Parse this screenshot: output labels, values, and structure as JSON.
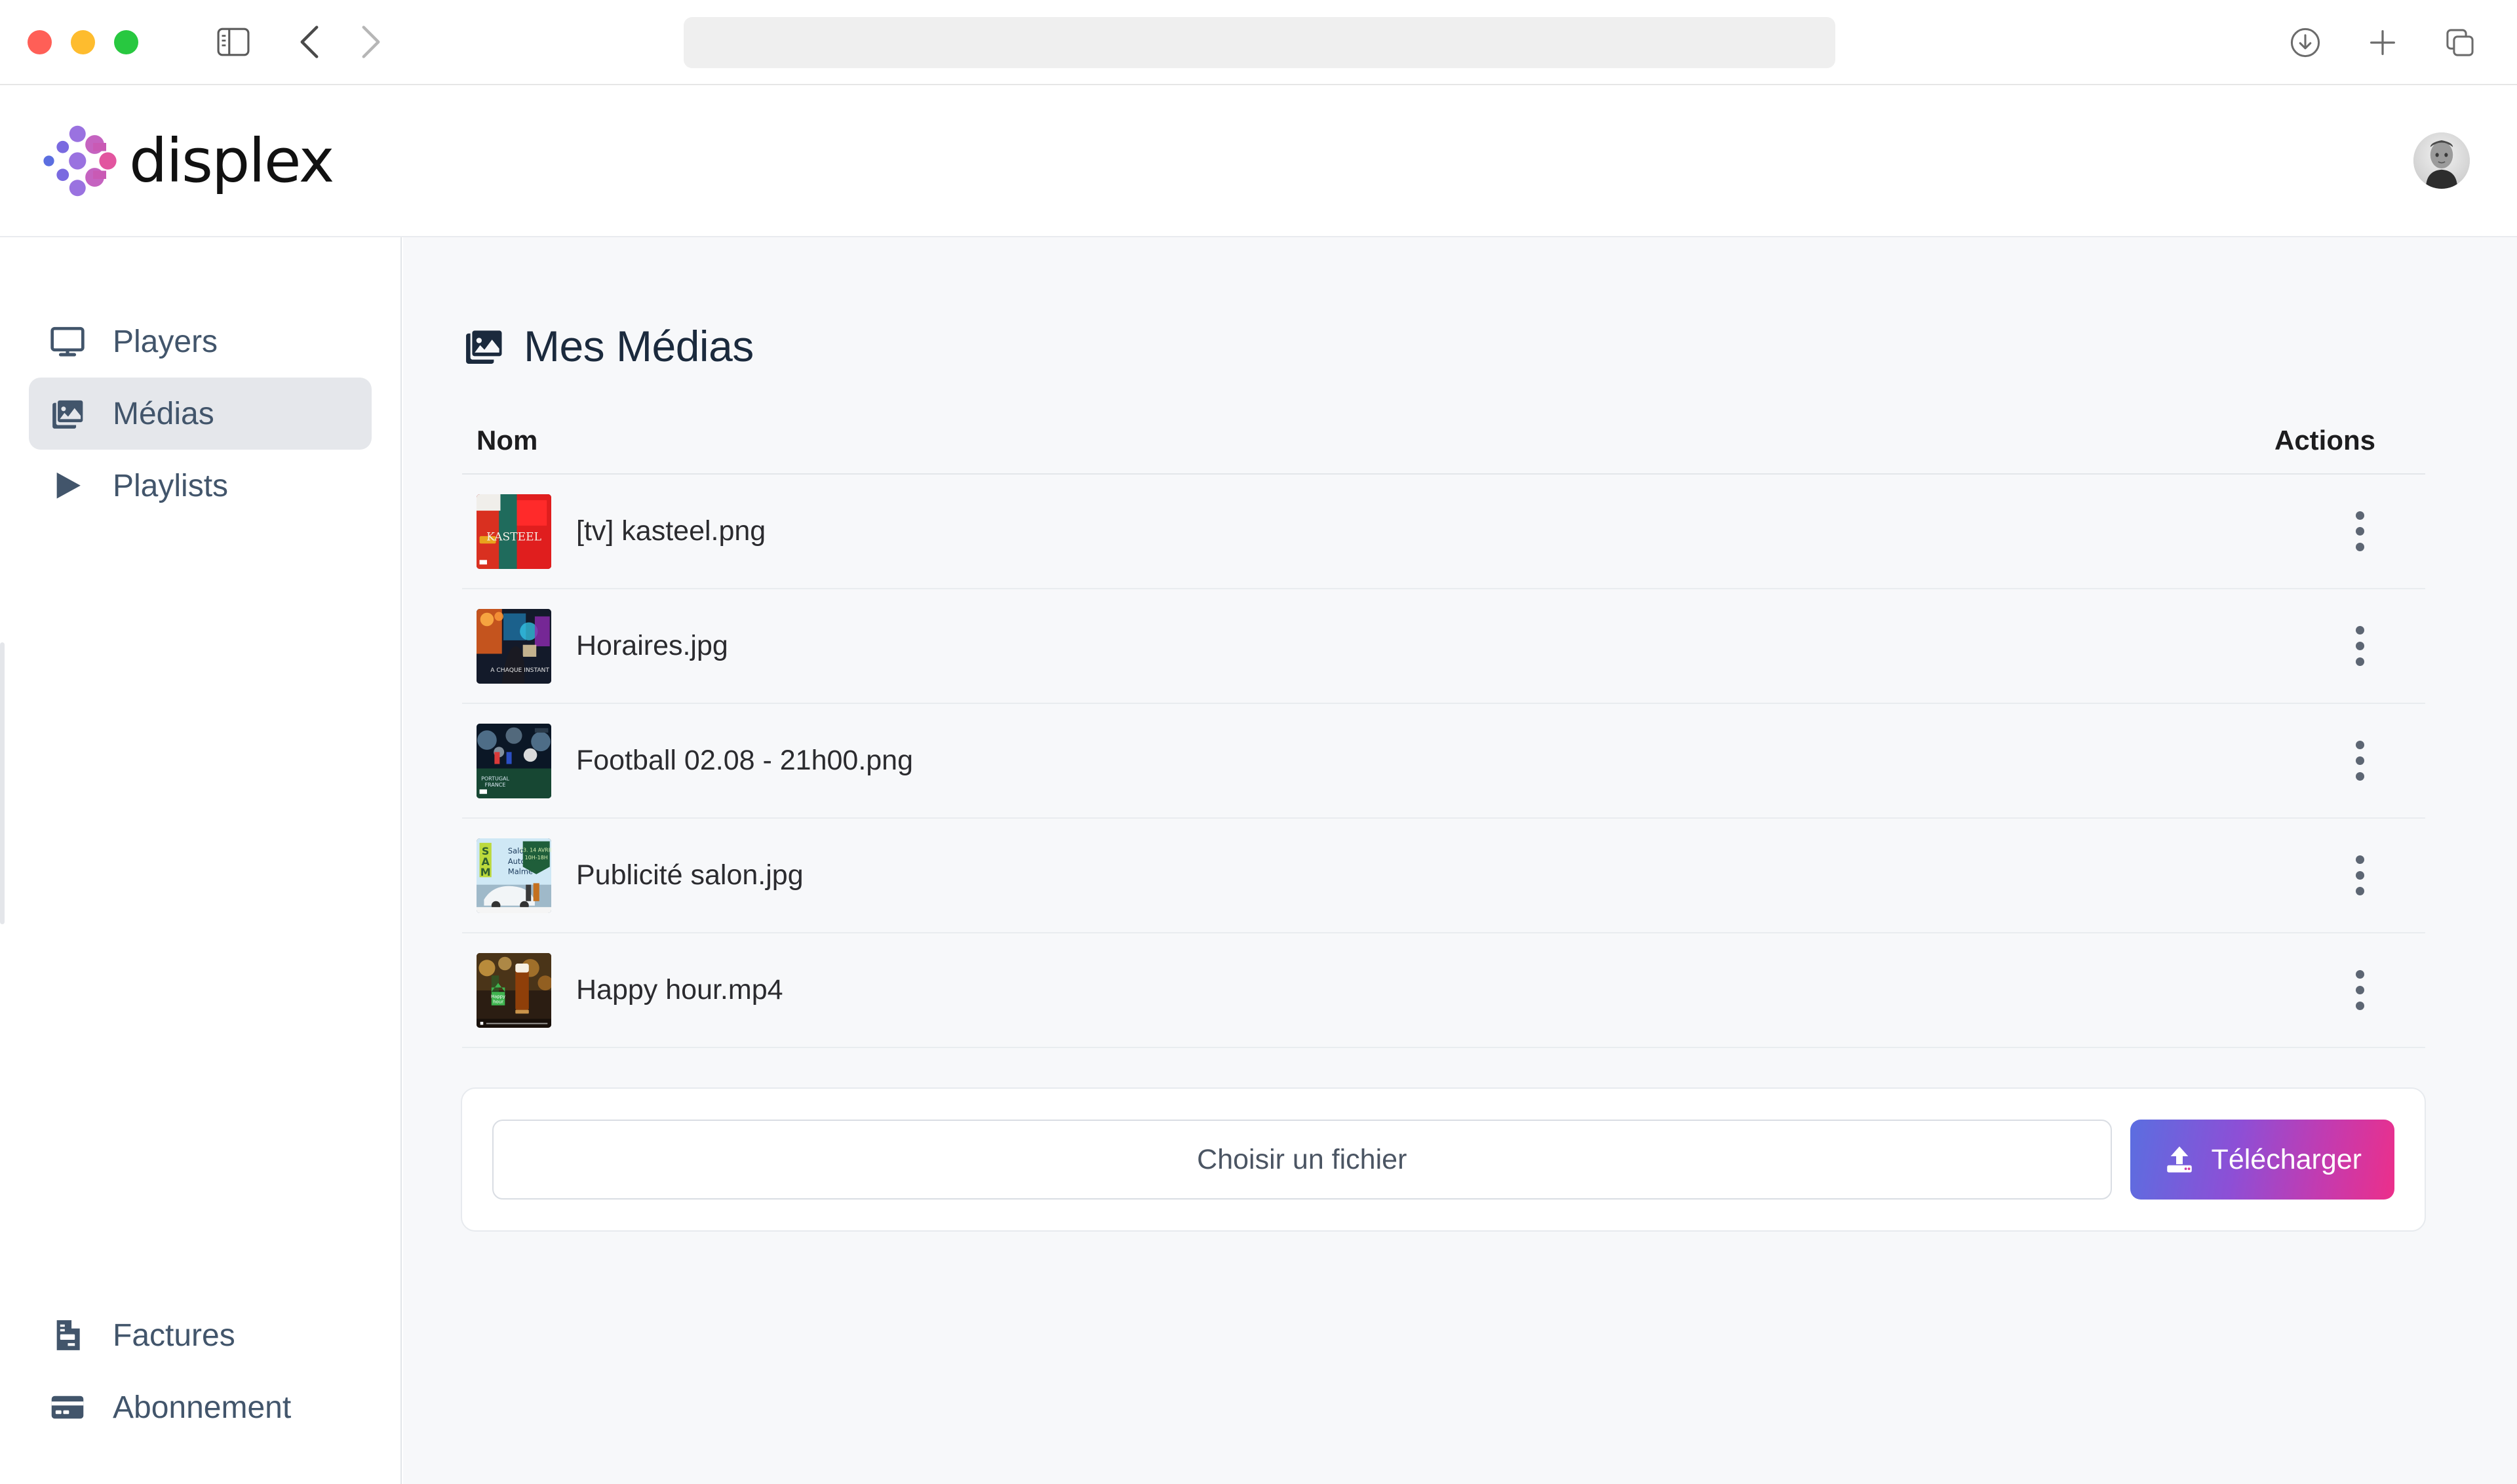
{
  "browser": {
    "traffic_lights": [
      "close",
      "minimize",
      "zoom"
    ],
    "sidebar_toggle": "sidebar-toggle",
    "back": "back",
    "forward": "forward",
    "address_value": "",
    "address_placeholder": "",
    "right_actions": [
      {
        "name": "downloads-icon",
        "label": "Downloads"
      },
      {
        "name": "new-tab-icon",
        "label": "New Tab"
      },
      {
        "name": "tab-overview-icon",
        "label": "Tab Overview"
      }
    ]
  },
  "app": {
    "brand_name": "displex",
    "avatar_alt": "User avatar"
  },
  "sidebar": {
    "top_items": [
      {
        "label": "Players",
        "icon": "monitor-icon",
        "active": false
      },
      {
        "label": "Médias",
        "icon": "images-icon",
        "active": true
      },
      {
        "label": "Playlists",
        "icon": "play-icon",
        "active": false
      }
    ],
    "bottom_items": [
      {
        "label": "Factures",
        "icon": "invoice-icon"
      },
      {
        "label": "Abonnement",
        "icon": "credit-card-icon"
      }
    ]
  },
  "main": {
    "page_title": "Mes Médias",
    "page_title_icon": "images-icon",
    "table": {
      "columns": [
        "Nom",
        "Actions"
      ],
      "rows": [
        {
          "name": "[tv] kasteel.png",
          "thumb": "kasteel-thumb"
        },
        {
          "name": "Horaires.jpg",
          "thumb": "horaires-thumb"
        },
        {
          "name": "Football 02.08 - 21h00.png",
          "thumb": "football-thumb"
        },
        {
          "name": "Publicité salon.jpg",
          "thumb": "publicite-thumb"
        },
        {
          "name": "Happy hour.mp4",
          "thumb": "happyhour-thumb"
        }
      ],
      "row_action_icon": "kebab-menu-icon"
    },
    "upload": {
      "file_chooser_label": "Choisir un fichier",
      "upload_button_label": "Télécharger",
      "upload_button_icon": "upload-icon"
    }
  },
  "colors": {
    "accent_start": "#5b6ee0",
    "accent_mid": "#8d4fd6",
    "accent_end": "#ec2f8a",
    "sidebar_text": "#42556b",
    "sidebar_active_bg": "#e5e7eb",
    "main_bg": "#f7f8fa",
    "title_text": "#1b2a3d"
  }
}
